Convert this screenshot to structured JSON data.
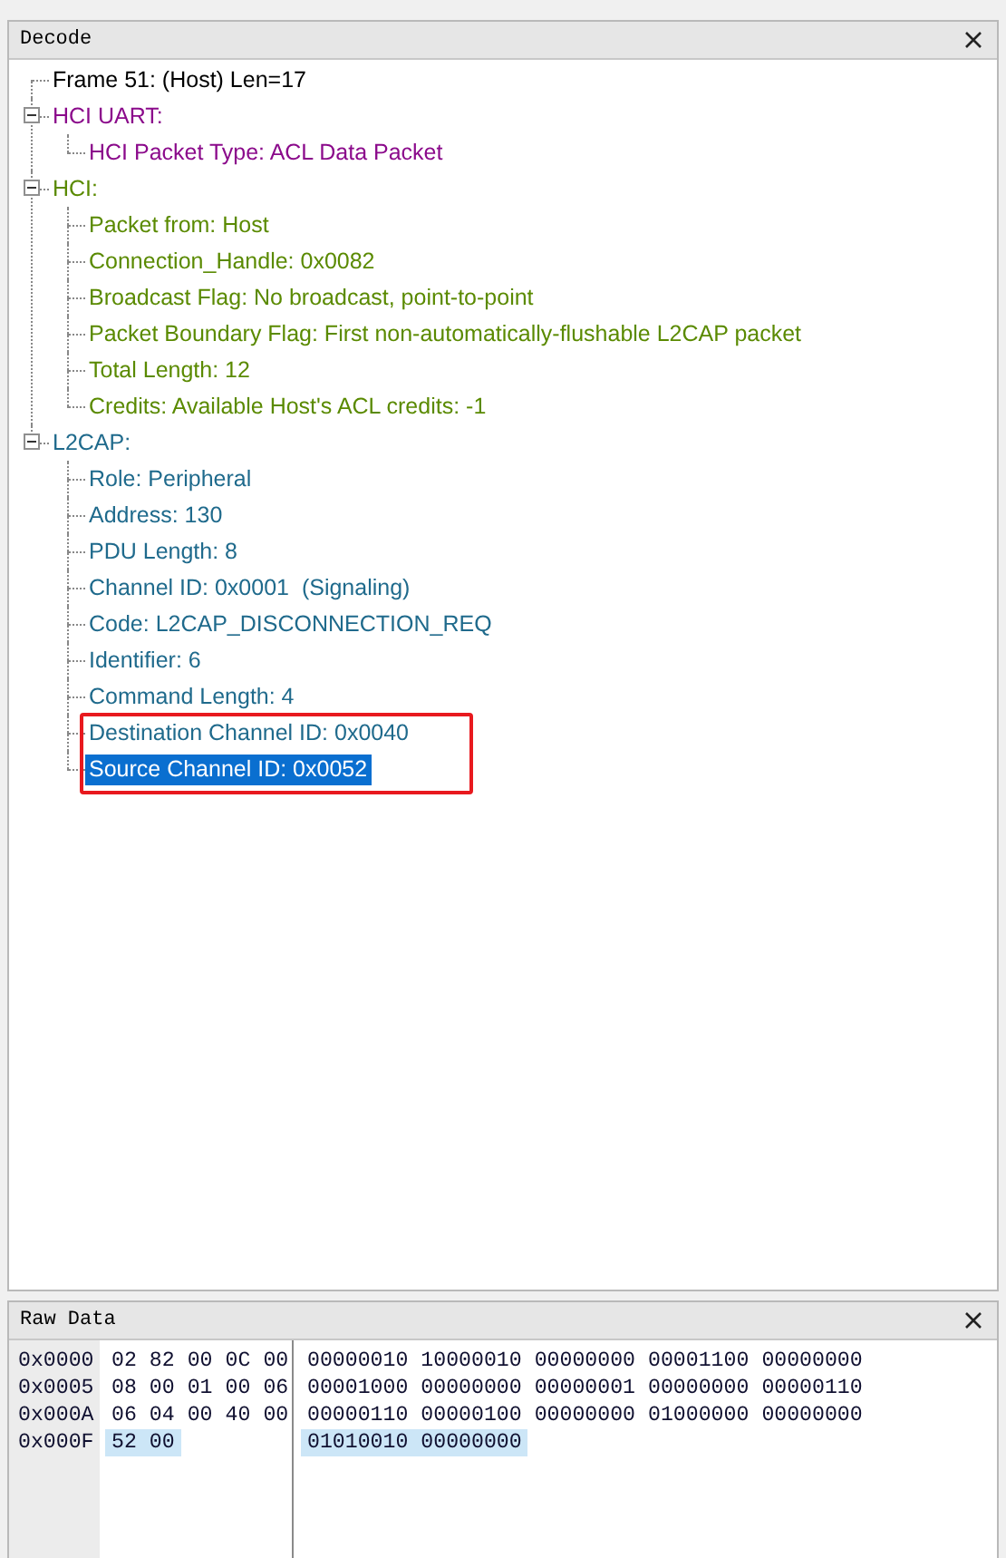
{
  "decode": {
    "title": "Decode",
    "tree": [
      {
        "kind": "leaf",
        "label": "Frame 51: (Host) Len=17",
        "color": "#000000"
      },
      {
        "kind": "group",
        "label": "HCI UART:",
        "color": "#8b0a8b",
        "expanded": true,
        "children": [
          {
            "label": "HCI Packet Type: ACL Data Packet",
            "selected": false,
            "highlighted": false
          }
        ]
      },
      {
        "kind": "group",
        "label": "HCI:",
        "color": "#5a8a00",
        "expanded": true,
        "children": [
          {
            "label": "Packet from: Host",
            "selected": false,
            "highlighted": false
          },
          {
            "label": "Connection_Handle: 0x0082",
            "selected": false,
            "highlighted": false
          },
          {
            "label": "Broadcast Flag: No broadcast, point-to-point",
            "selected": false,
            "highlighted": false
          },
          {
            "label": "Packet Boundary Flag: First non-automatically-flushable L2CAP packet",
            "selected": false,
            "highlighted": false
          },
          {
            "label": "Total Length: 12",
            "selected": false,
            "highlighted": false
          },
          {
            "label": "Credits: Available Host's ACL credits: -1",
            "selected": false,
            "highlighted": false
          }
        ]
      },
      {
        "kind": "group",
        "label": "L2CAP:",
        "color": "#1f6a8c",
        "expanded": true,
        "children": [
          {
            "label": "Role: Peripheral",
            "selected": false,
            "highlighted": false
          },
          {
            "label": "Address: 130",
            "selected": false,
            "highlighted": false
          },
          {
            "label": "PDU Length: 8",
            "selected": false,
            "highlighted": false
          },
          {
            "label": "Channel ID: 0x0001  (Signaling)",
            "selected": false,
            "highlighted": false
          },
          {
            "label": "Code: L2CAP_DISCONNECTION_REQ",
            "selected": false,
            "highlighted": false
          },
          {
            "label": "Identifier: 6",
            "selected": false,
            "highlighted": false
          },
          {
            "label": "Command Length: 4",
            "selected": false,
            "highlighted": false
          },
          {
            "label": "Destination Channel ID: 0x0040",
            "selected": false,
            "highlighted": true
          },
          {
            "label": "Source Channel ID: 0x0052",
            "selected": true,
            "highlighted": true
          }
        ]
      }
    ]
  },
  "raw_data": {
    "title": "Raw Data",
    "rows": [
      {
        "offset": "0x0000",
        "bytes": [
          {
            "hex": "02",
            "bits": "00000010",
            "selected": false
          },
          {
            "hex": "82",
            "bits": "10000010",
            "selected": false
          },
          {
            "hex": "00",
            "bits": "00000000",
            "selected": false
          },
          {
            "hex": "0C",
            "bits": "00001100",
            "selected": false
          },
          {
            "hex": "00",
            "bits": "00000000",
            "selected": false
          }
        ]
      },
      {
        "offset": "0x0005",
        "bytes": [
          {
            "hex": "08",
            "bits": "00001000",
            "selected": false
          },
          {
            "hex": "00",
            "bits": "00000000",
            "selected": false
          },
          {
            "hex": "01",
            "bits": "00000001",
            "selected": false
          },
          {
            "hex": "00",
            "bits": "00000000",
            "selected": false
          },
          {
            "hex": "06",
            "bits": "00000110",
            "selected": false
          }
        ]
      },
      {
        "offset": "0x000A",
        "bytes": [
          {
            "hex": "06",
            "bits": "00000110",
            "selected": false
          },
          {
            "hex": "04",
            "bits": "00000100",
            "selected": false
          },
          {
            "hex": "00",
            "bits": "00000000",
            "selected": false
          },
          {
            "hex": "40",
            "bits": "01000000",
            "selected": false
          },
          {
            "hex": "00",
            "bits": "00000000",
            "selected": false
          }
        ]
      },
      {
        "offset": "0x000F",
        "bytes": [
          {
            "hex": "52",
            "bits": "01010010",
            "selected": true
          },
          {
            "hex": "00",
            "bits": "00000000",
            "selected": true
          }
        ]
      }
    ]
  }
}
